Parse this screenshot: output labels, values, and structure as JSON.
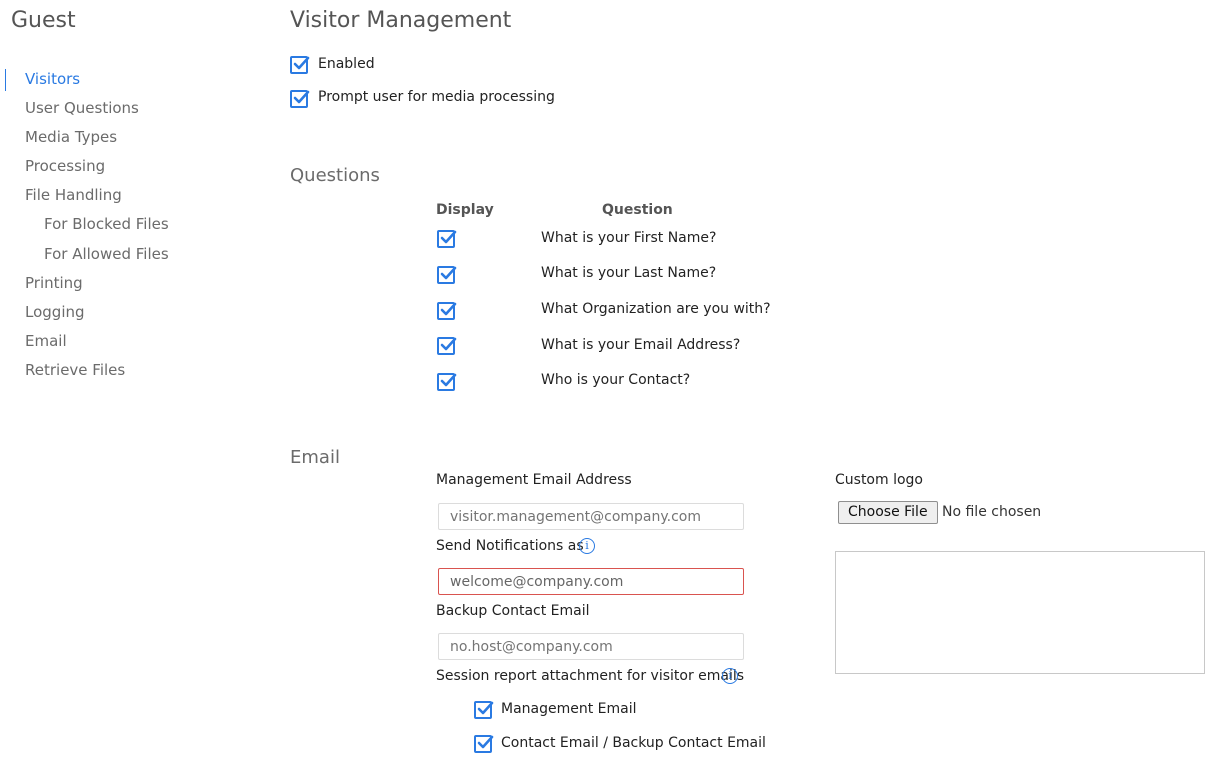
{
  "sidebar": {
    "title": "Guest",
    "items": [
      {
        "label": "Visitors",
        "active": true
      },
      {
        "label": "User Questions"
      },
      {
        "label": "Media Types"
      },
      {
        "label": "Processing"
      },
      {
        "label": "File Handling"
      },
      {
        "label": "For Blocked Files",
        "sub": true
      },
      {
        "label": "For Allowed Files",
        "sub": true
      },
      {
        "label": "Printing"
      },
      {
        "label": "Logging"
      },
      {
        "label": "Email"
      },
      {
        "label": "Retrieve Files"
      }
    ]
  },
  "page": {
    "title": "Visitor Management",
    "enabled": {
      "label": "Enabled",
      "checked": true
    },
    "prompt_media": {
      "label": "Prompt user for media processing",
      "checked": true
    }
  },
  "questions": {
    "title": "Questions",
    "header_display": "Display",
    "header_question": "Question",
    "rows": [
      {
        "text": "What is your First Name?",
        "checked": true
      },
      {
        "text": "What is your Last Name?",
        "checked": true
      },
      {
        "text": "What Organization are you with?",
        "checked": true
      },
      {
        "text": "What is your Email Address?",
        "checked": true
      },
      {
        "text": "Who is your Contact?",
        "checked": true
      }
    ]
  },
  "email": {
    "title": "Email",
    "management_label": "Management Email Address",
    "management_placeholder": "visitor.management@company.com",
    "notifications_label": "Send Notifications as",
    "notifications_value": "welcome@company.com",
    "backup_label": "Backup Contact Email",
    "backup_placeholder": "no.host@company.com",
    "session_label": "Session report attachment for visitor emails",
    "management_email": {
      "label": "Management Email",
      "checked": true
    },
    "contact_email": {
      "label": "Contact Email / Backup Contact Email",
      "checked": true
    },
    "custom_logo_label": "Custom logo",
    "choose_file": "Choose File",
    "no_file": "No file chosen"
  },
  "icons": {
    "info": "info-icon",
    "check": "checkmark-icon"
  },
  "colors": {
    "accent": "#2a7ae2",
    "error": "#d9534f"
  }
}
